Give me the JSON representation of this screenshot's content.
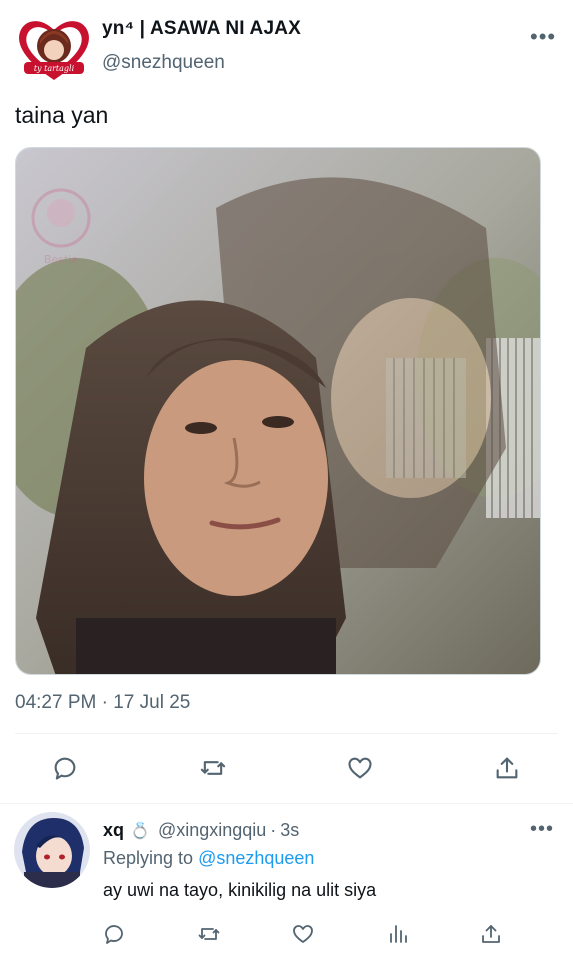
{
  "tweet": {
    "display_name": "yn⁴ | ASAWA NI AJAX",
    "handle": "@snezhqueen",
    "more_icon": "ellipsis-icon",
    "text": "taina yan",
    "image_description": "photo-collage",
    "image_watermark": "Bestie",
    "timestamp": "04:27 PM · 17 Jul 25",
    "actions": [
      "reply-icon",
      "retweet-icon",
      "like-icon",
      "share-icon"
    ]
  },
  "reply": {
    "display_name": "xq",
    "emoji": "💍",
    "handle": "@xingxingqiu",
    "separator": "·",
    "time": "3s",
    "replying_prefix": "Replying to",
    "replying_to": "@snezhqueen",
    "text": "ay uwi na tayo, kinikilig na ulit siya",
    "actions": [
      "reply-icon",
      "retweet-icon",
      "like-icon",
      "views-icon",
      "share-icon"
    ]
  },
  "colors": {
    "text": "#0f1419",
    "secondary": "#536471",
    "link": "#1d9bf0",
    "divider": "#eff3f4"
  }
}
